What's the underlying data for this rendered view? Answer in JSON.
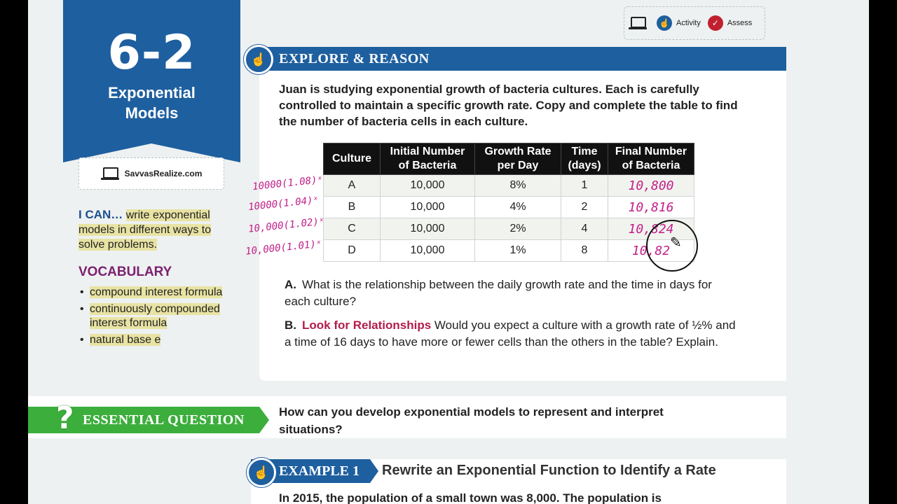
{
  "lesson": {
    "number": "6-2",
    "title_line1": "Exponential",
    "title_line2": "Models",
    "realize_link": "SavvasRealize.com"
  },
  "ican": {
    "lead": "I CAN…",
    "text": "write exponential models in different ways to solve problems."
  },
  "vocabulary": {
    "heading": "VOCABULARY",
    "items": [
      "compound interest formula",
      "continuously compounded interest formula",
      "natural base e"
    ]
  },
  "toolbar": {
    "activity_label": "Activity",
    "assess_label": "Assess"
  },
  "explore": {
    "title": "EXPLORE & REASON",
    "intro": "Juan is studying exponential growth of bacteria cultures. Each is carefully controlled to maintain a specific growth rate. Copy and complete the table to find the number of bacteria cells in each culture."
  },
  "table": {
    "headers": [
      "Culture",
      "Initial Number of Bacteria",
      "Growth Rate per Day",
      "Time (days)",
      "Final Number of Bacteria"
    ],
    "rows": [
      [
        "A",
        "10,000",
        "8%",
        "1",
        "10,800"
      ],
      [
        "B",
        "10,000",
        "4%",
        "2",
        "10,816"
      ],
      [
        "C",
        "10,000",
        "2%",
        "4",
        "10,824"
      ],
      [
        "D",
        "10,000",
        "1%",
        "8",
        "10,82"
      ]
    ]
  },
  "handwriting": [
    "10000(1.08)ˣ",
    "10000(1.04)ˣ",
    "10,000(1.02)ˣ",
    "10,000(1.01)ˣ"
  ],
  "questions": {
    "a_label": "A.",
    "a_text": "What is the relationship between the daily growth rate and the time in days for each culture?",
    "b_label": "B.",
    "b_highlight": "Look for Relationships",
    "b_text_1": "Would you expect a culture with a growth rate of",
    "b_fraction": "½%",
    "b_text_2": "and a time of 16 days to have more or fewer cells than the others in the table? Explain."
  },
  "essential": {
    "symbol": "?",
    "title": "ESSENTIAL QUESTION",
    "text": "How can you develop exponential models to represent and interpret situations?"
  },
  "example": {
    "label": "EXAMPLE 1",
    "title": "Rewrite an Exponential Function to Identify a Rate",
    "text": "In 2015, the population of a small town was 8,000. The population is"
  },
  "colors": {
    "brand_blue": "#1e5f9f",
    "essential_green": "#3cae3c",
    "highlight": "#e8e3a3",
    "vocab_purple": "#7b2070",
    "ink": "#c21f8a"
  }
}
